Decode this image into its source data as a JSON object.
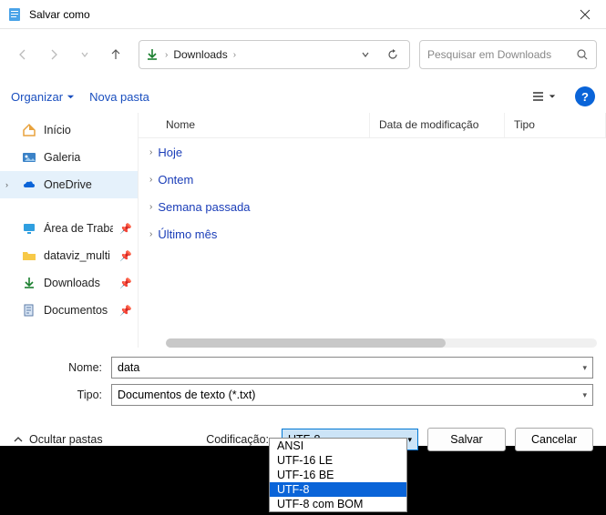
{
  "titlebar": {
    "title": "Salvar como"
  },
  "nav": {
    "location": "Downloads",
    "search_placeholder": "Pesquisar em Downloads"
  },
  "toolbar": {
    "organize": "Organizar",
    "new_folder": "Nova pasta"
  },
  "sidebar": {
    "home": "Início",
    "gallery": "Galeria",
    "onedrive": "OneDrive",
    "desktop": "Área de Trabalho",
    "dataviz": "dataviz_multi",
    "downloads": "Downloads",
    "documents": "Documentos"
  },
  "columns": {
    "name": "Nome",
    "date": "Data de modificação",
    "type": "Tipo"
  },
  "groups": {
    "today": "Hoje",
    "yesterday": "Ontem",
    "lastweek": "Semana passada",
    "lastmonth": "Último mês"
  },
  "fields": {
    "name_label": "Nome:",
    "name_value": "data",
    "type_label": "Tipo:",
    "type_value": "Documentos de texto (*.txt)"
  },
  "bottom": {
    "hide_folders": "Ocultar pastas",
    "encoding_label": "Codificação:",
    "encoding_value": "UTF-8",
    "save": "Salvar",
    "cancel": "Cancelar"
  },
  "encoding_options": {
    "o0": "ANSI",
    "o1": "UTF-16 LE",
    "o2": "UTF-16 BE",
    "o3": "UTF-8",
    "o4": "UTF-8 com BOM"
  }
}
